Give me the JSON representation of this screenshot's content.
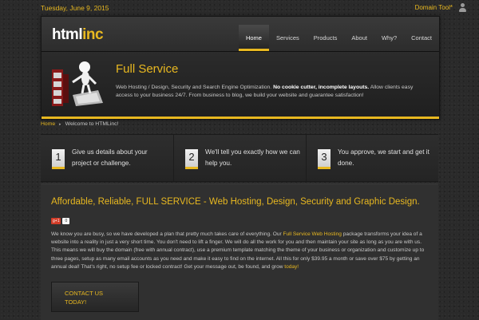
{
  "topbar": {
    "date": "Tuesday, June 9, 2015",
    "domain_tool": "Domain Tool*"
  },
  "logo": {
    "part1": "html",
    "part2": "inc"
  },
  "nav": {
    "items": [
      "Home",
      "Services",
      "Products",
      "About",
      "Why?",
      "Contact"
    ],
    "active": "Home"
  },
  "banner": {
    "title": "Full Service",
    "text_1": "Web Hosting / Design, Security and Search Engine Optimization.",
    "text_bold": "No cookie cutter, incomplete layouts.",
    "text_2": "Allow clients easy access to your business 24/7. From business to blog, we build your website and guarantee satisfaction!"
  },
  "breadcrumb": {
    "home": "Home",
    "current": "Welcome to HTMLinc!"
  },
  "steps": [
    {
      "num": "1",
      "text": "Give us details about your project or challenge."
    },
    {
      "num": "2",
      "text": "We'll tell you exactly how we can help you."
    },
    {
      "num": "3",
      "text": "You approve, we start and get it done."
    }
  ],
  "content": {
    "title": "Affordable, Reliable, FULL SERVICE - Web Hosting, Design, Security and Graphic Design.",
    "share_label": "g+1",
    "share_count": "0",
    "p1": "We know you are busy, so we have developed a plan that pretty much takes care of everything. Our ",
    "link1": "Full Service Web Hosting",
    "p2": " package transforms your idea of a website into a reality in just a very short time. You don't need to lift a finger. We will do all the work for you and then maintain your site as long as you are with us. This means we will buy the domain (free with annual contract), use a premium template matching the theme of your business or organization and customize up to three pages, setup as many email accounts as you need and make it easy to find on the internet. All this for only $39.95 a month or save over $75 by getting an annual deal! That's right, no setup fee or locked contract! Get your message out, be found, and grow ",
    "link2": "today!",
    "cta_line1": "CONTACT US",
    "cta_line2": "TODAY!"
  },
  "colors": {
    "accent": "#e8b820",
    "background": "#2a2a2a",
    "text": "#bdbdbd"
  }
}
